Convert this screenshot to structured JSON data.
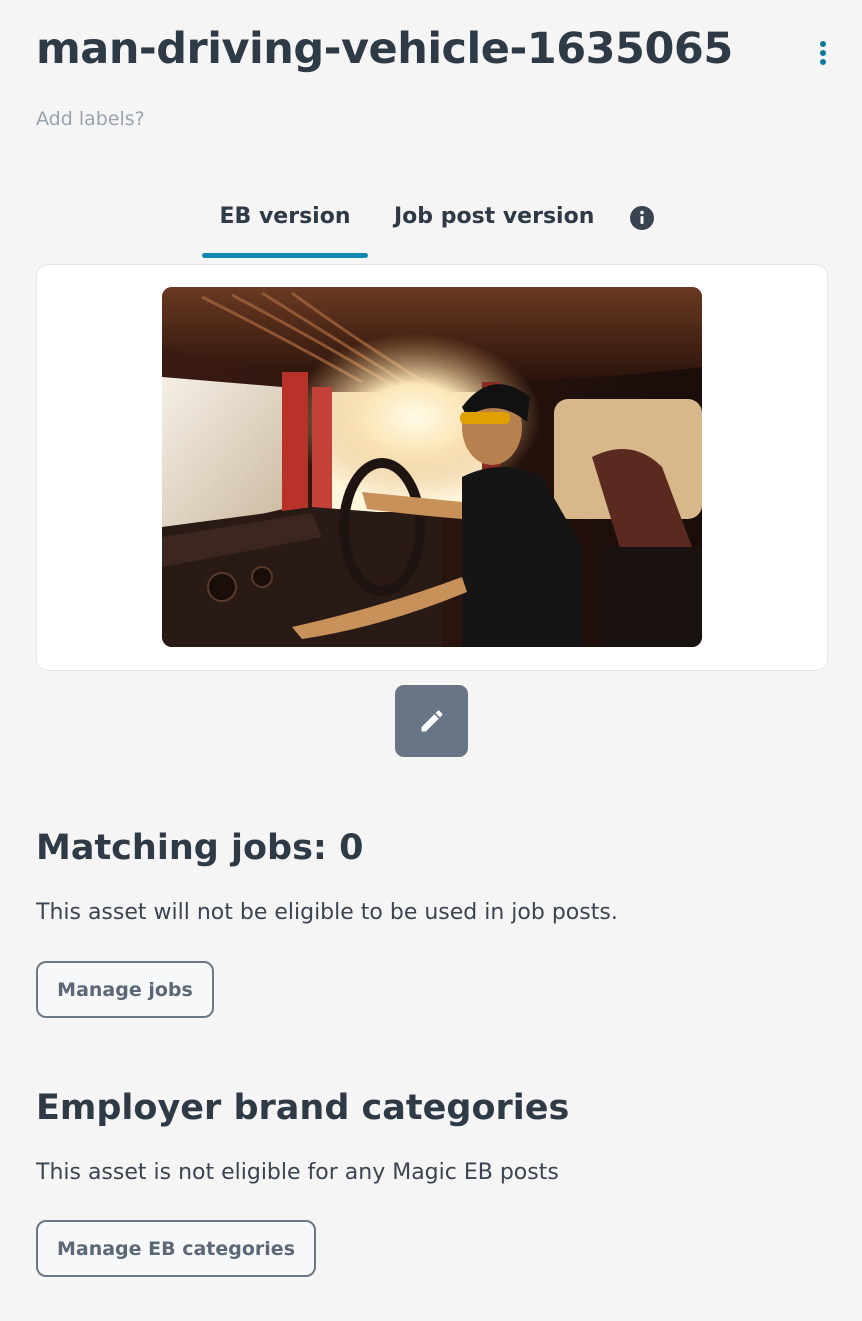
{
  "header": {
    "title": "man-driving-vehicle-1635065",
    "menu_icon": "more-vertical-icon",
    "add_labels": "Add labels?"
  },
  "tabs": {
    "items": [
      {
        "label": "EB version",
        "active": true
      },
      {
        "label": "Job post version",
        "active": false
      }
    ],
    "info_icon": "info-icon"
  },
  "preview": {
    "alt": "man-driving-vehicle-1635065",
    "edit_icon": "pencil-icon"
  },
  "matching_jobs": {
    "heading": "Matching jobs: 0",
    "description": "This asset will not be eligible to be used in job posts.",
    "button_label": "Manage jobs"
  },
  "eb_categories": {
    "heading": "Employer brand categories",
    "description": "This asset is not eligible for any Magic EB posts",
    "button_label": "Manage EB categories"
  },
  "colors": {
    "accent": "#0e89b0",
    "edit_button": "#687585",
    "background": "#f5f5f6"
  }
}
